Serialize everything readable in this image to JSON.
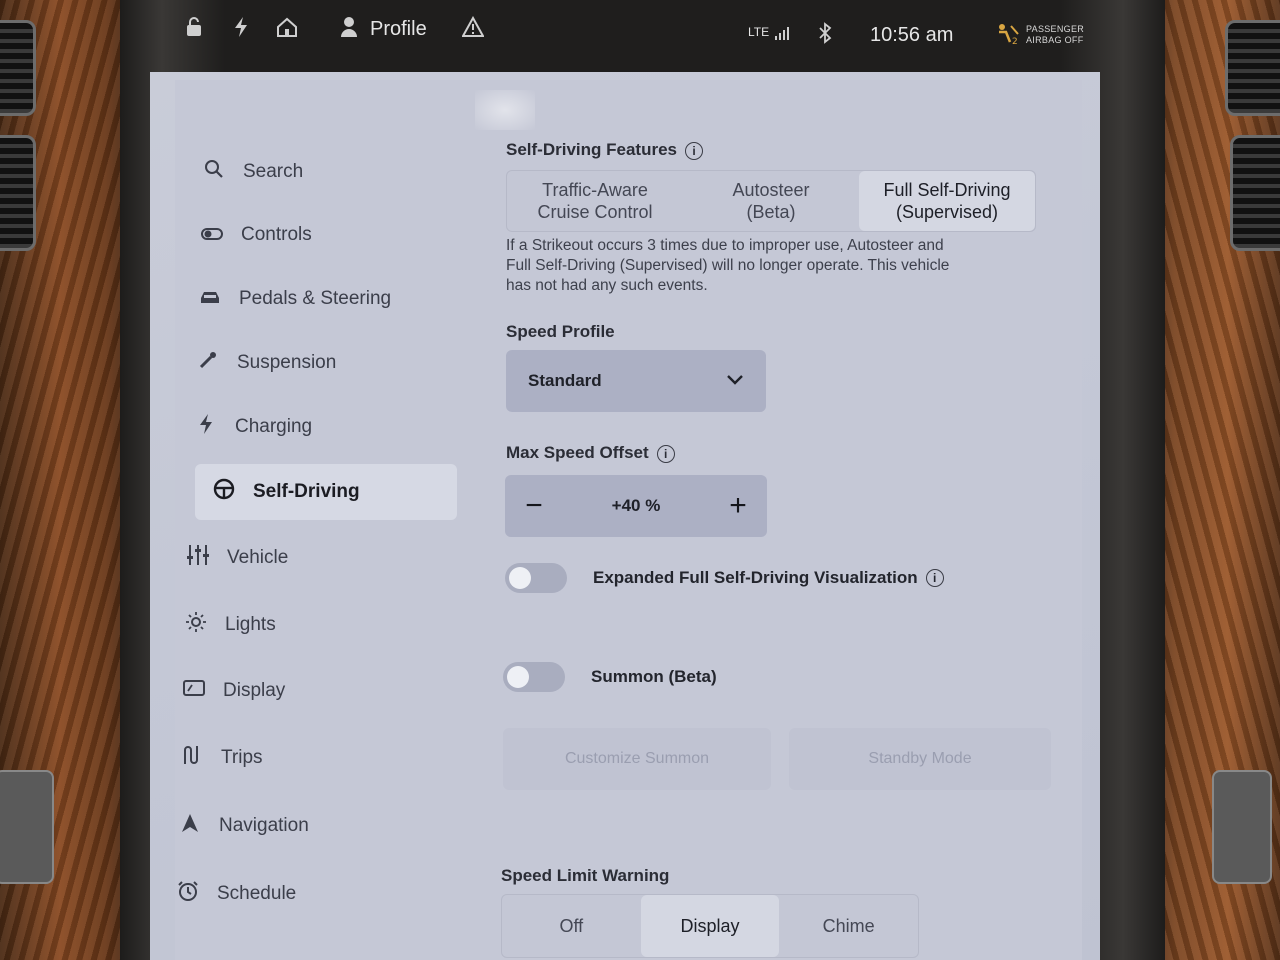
{
  "status_bar": {
    "profile_label": "Profile",
    "network": "LTE",
    "time": "10:56 am",
    "airbag_line1": "PASSENGER",
    "airbag_line2": "AIRBAG OFF",
    "icons": [
      "lock-icon",
      "bolt-icon",
      "home-icon",
      "person-icon",
      "warning-icon",
      "signal-icon",
      "bluetooth-icon",
      "airbag-icon"
    ]
  },
  "sidebar": {
    "items": [
      {
        "label": "Search",
        "icon": "search-icon"
      },
      {
        "label": "Controls",
        "icon": "toggle-icon"
      },
      {
        "label": "Pedals & Steering",
        "icon": "car-icon"
      },
      {
        "label": "Suspension",
        "icon": "wrench-icon"
      },
      {
        "label": "Charging",
        "icon": "bolt-icon"
      },
      {
        "label": "Self-Driving",
        "icon": "steering-wheel-icon",
        "active": true
      },
      {
        "label": "Vehicle",
        "icon": "sliders-icon"
      },
      {
        "label": "Lights",
        "icon": "sun-icon"
      },
      {
        "label": "Display",
        "icon": "display-icon"
      },
      {
        "label": "Trips",
        "icon": "trips-icon"
      },
      {
        "label": "Navigation",
        "icon": "navigation-arrow-icon"
      },
      {
        "label": "Schedule",
        "icon": "alarm-clock-icon"
      }
    ]
  },
  "self_driving": {
    "features_title": "Self-Driving Features",
    "features": [
      {
        "line1": "Traffic-Aware",
        "line2": "Cruise Control",
        "selected": false
      },
      {
        "line1": "Autosteer",
        "line2": "(Beta)",
        "selected": false
      },
      {
        "line1": "Full Self-Driving",
        "line2": "(Supervised)",
        "selected": true
      }
    ],
    "strikeout_note_1": "If a Strikeout occurs 3 times due to improper use, Autosteer and",
    "strikeout_note_2": "Full Self-Driving (Supervised) will no longer operate. This vehicle",
    "strikeout_note_3": "has not had any such events.",
    "speed_profile_title": "Speed Profile",
    "speed_profile_value": "Standard",
    "max_speed_offset_title": "Max Speed Offset",
    "max_speed_offset_value": "+40 %",
    "expanded_viz_label": "Expanded Full Self-Driving Visualization",
    "expanded_viz_on": false,
    "summon_label": "Summon (Beta)",
    "summon_on": false,
    "customize_summon_label": "Customize Summon",
    "standby_mode_label": "Standby Mode",
    "speed_limit_warning_title": "Speed Limit Warning",
    "speed_limit_options": [
      {
        "label": "Off",
        "selected": false
      },
      {
        "label": "Display",
        "selected": true
      },
      {
        "label": "Chime",
        "selected": false
      }
    ]
  }
}
